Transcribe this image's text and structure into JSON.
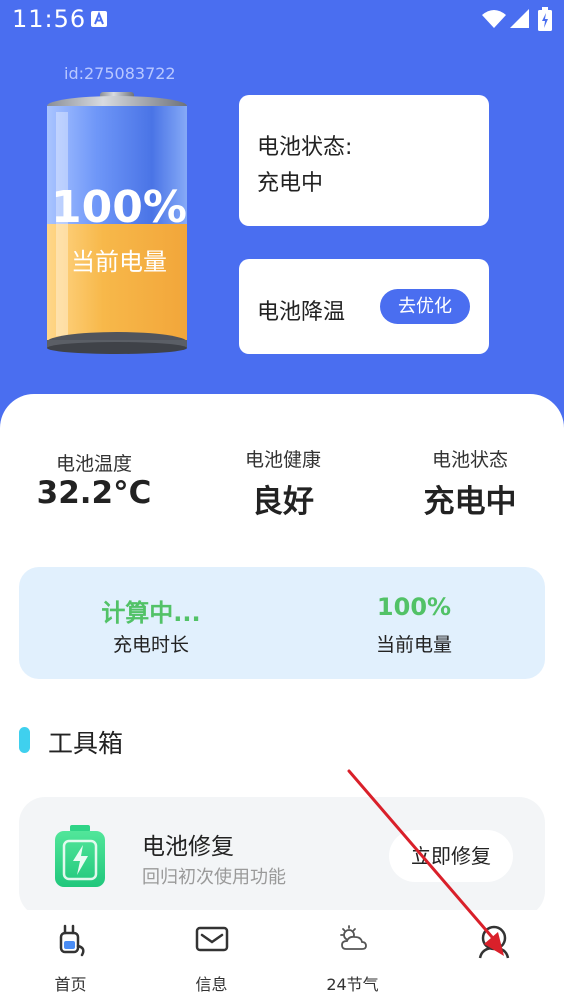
{
  "status_bar": {
    "time": "11:56"
  },
  "header": {
    "user_id": "id:275083722"
  },
  "battery": {
    "percent": "100%",
    "caption": "当前电量",
    "level": 0.5
  },
  "status_card": {
    "title": "电池状态:",
    "value": "充电中"
  },
  "cooling_card": {
    "title": "电池降温",
    "button": "去优化"
  },
  "stats": [
    {
      "label": "电池温度",
      "value": "32.2°C"
    },
    {
      "label": "电池健康",
      "value": "良好"
    },
    {
      "label": "电池状态",
      "value": "充电中"
    }
  ],
  "info": {
    "charge_time_value": "计算中...",
    "charge_time_label": "充电时长",
    "level_value": "100%",
    "level_label": "当前电量"
  },
  "toolbox": {
    "title": "工具箱",
    "items": [
      {
        "title": "电池修复",
        "subtitle": "回归初次使用功能",
        "button": "立即修复"
      }
    ]
  },
  "nav": [
    {
      "label": "首页",
      "icon": "charger-icon"
    },
    {
      "label": "信息",
      "icon": "mail-icon"
    },
    {
      "label": "24节气",
      "icon": "weather-icon"
    },
    {
      "label": "",
      "icon": "user-icon"
    }
  ],
  "colors": {
    "primary": "#4a6ef0",
    "accent_green": "#52c267",
    "battery_fill": "#f7b84a",
    "annotation_arrow": "#d9202a"
  }
}
